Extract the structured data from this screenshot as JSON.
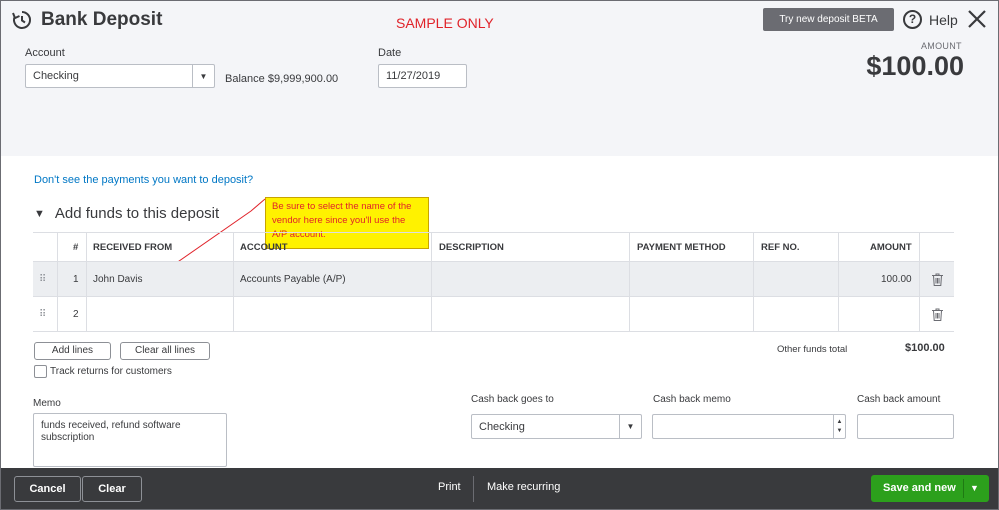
{
  "header": {
    "title": "Bank Deposit",
    "sample_label": "SAMPLE ONLY",
    "try_button": "Try new deposit BETA",
    "help_label": "Help",
    "amount_caption": "AMOUNT",
    "amount_total": "$100.00"
  },
  "account": {
    "label": "Account",
    "value": "Checking",
    "balance_label": "Balance",
    "balance_value": "$9,999,900.00"
  },
  "date": {
    "label": "Date",
    "value": "11/27/2019"
  },
  "payments_link": "Don't see the payments you want to deposit?",
  "section_title": "Add funds to this deposit",
  "callout_text": "Be sure to select the name of the vendor here since you'll use the A/P account.",
  "table": {
    "headers": [
      "#",
      "RECEIVED FROM",
      "ACCOUNT",
      "DESCRIPTION",
      "PAYMENT METHOD",
      "REF NO.",
      "AMOUNT"
    ],
    "rows": [
      {
        "num": "1",
        "received_from": "John Davis",
        "account": "Accounts Payable (A/P)",
        "description": "",
        "payment_method": "",
        "ref_no": "",
        "amount": "100.00"
      },
      {
        "num": "2",
        "received_from": "",
        "account": "",
        "description": "",
        "payment_method": "",
        "ref_no": "",
        "amount": ""
      }
    ]
  },
  "actions": {
    "add_lines": "Add lines",
    "clear_all_lines": "Clear all lines",
    "track_returns": "Track returns for customers",
    "other_funds_label": "Other funds total",
    "other_funds_value": "$100.00"
  },
  "memo": {
    "label": "Memo",
    "value": "funds received, refund software subscription"
  },
  "cash_back": {
    "goes_to_label": "Cash back goes to",
    "goes_to_value": "Checking",
    "memo_label": "Cash back memo",
    "amount_label": "Cash back amount"
  },
  "footer": {
    "cancel": "Cancel",
    "clear": "Clear",
    "print": "Print",
    "make_recurring": "Make recurring",
    "save_and_new": "Save and new"
  },
  "colors": {
    "link": "#0077c5",
    "primary_button": "#2ca01c",
    "callout_bg": "#fff200",
    "sample_text": "#e0232a",
    "footer_bg": "#393a3d"
  }
}
